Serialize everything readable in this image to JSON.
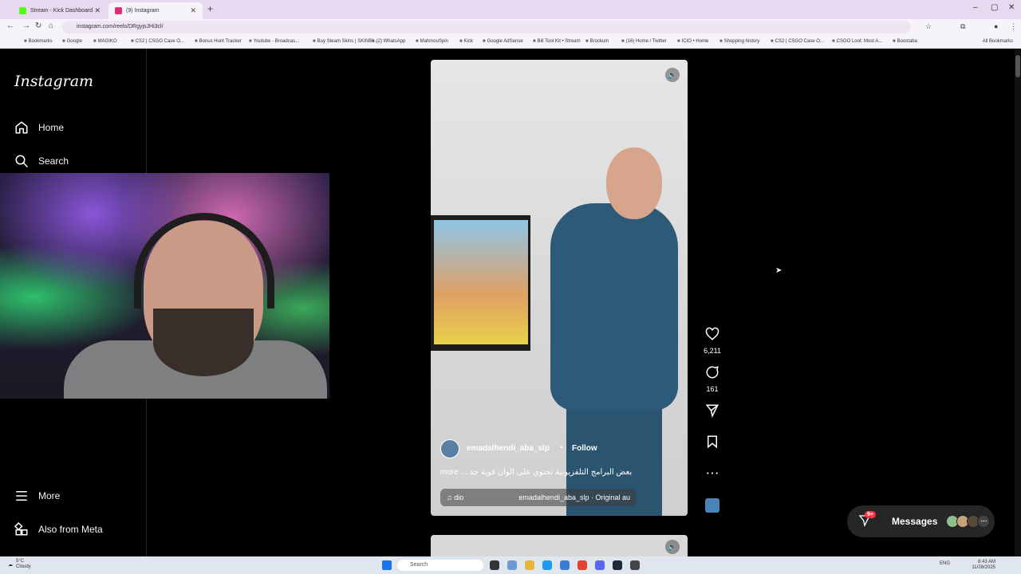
{
  "browser": {
    "tabs": [
      {
        "label": "Stream - Kick Dashboard",
        "favicon_color": "#53fc18"
      },
      {
        "label": "(9) Instagram",
        "favicon_color": "#e1306c"
      }
    ],
    "new_tab": "+",
    "url": "instagram.com/reels/DRgyjsJHi3cl/",
    "bookmarks": [
      "Bookmarks",
      "Google",
      "MAGIKO",
      "CS2 | CSGO Case O...",
      "Bonus Hunt Tracker",
      "Youtube - Broadcas...",
      "Buy Steam Skins | SKINBI...",
      "(2) WhatsApp",
      "MahmouSpin",
      "Kick",
      "Google AdSense",
      "Bill Tool Kit • Stream",
      "Brockum",
      "(16) Home / Twitter",
      "ICIO • Home",
      "Shopping history",
      "CS2 | CSGO Case O...",
      "CSGO Loot: Most A...",
      "Boostaba"
    ],
    "all_bookmarks": "All Bookmarks"
  },
  "sidebar": {
    "logo": "Instagram",
    "items": [
      {
        "label": "Home",
        "icon": "home-icon"
      },
      {
        "label": "Search",
        "icon": "search-icon"
      },
      {
        "label": "More",
        "icon": "menu-icon"
      },
      {
        "label": "Also from Meta",
        "icon": "grid-icon"
      }
    ]
  },
  "reel": {
    "username": "emadalhendi_aba_slp",
    "separator": "•",
    "follow": "Follow",
    "caption": "more ... بعض البرامج التلفزيونية تحتوي على ألوان قوية جد",
    "audio_label": "dio",
    "audio_source": "emadalhendi_aba_slp · Original au",
    "likes": "6,211",
    "comments": "161"
  },
  "messages": {
    "label": "Messages",
    "badge": "9+"
  },
  "taskbar": {
    "weather_temp": "5°C",
    "weather_desc": "Cloudy",
    "search_placeholder": "Search",
    "lang": "ENG",
    "time": "8:43 AM",
    "date": "11/28/2025"
  },
  "colors": {
    "accent": "#0095f6",
    "badge": "#ff3040",
    "background": "#000000"
  }
}
